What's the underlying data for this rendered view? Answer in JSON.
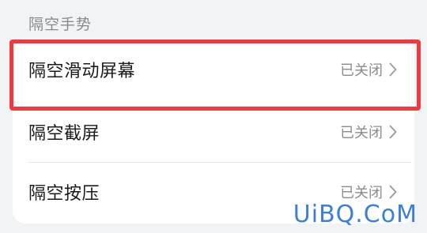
{
  "section": {
    "title": "隔空手势"
  },
  "rows": [
    {
      "label": "隔空滑动屏幕",
      "status": "已关闭"
    },
    {
      "label": "隔空截屏",
      "status": "已关闭"
    },
    {
      "label": "隔空按压",
      "status": "已关闭"
    }
  ],
  "watermark": "UiBQ.CoM",
  "colors": {
    "highlight": "#f03a3f",
    "watermark": "#3b7fd8",
    "background": "#f1f3f5"
  }
}
